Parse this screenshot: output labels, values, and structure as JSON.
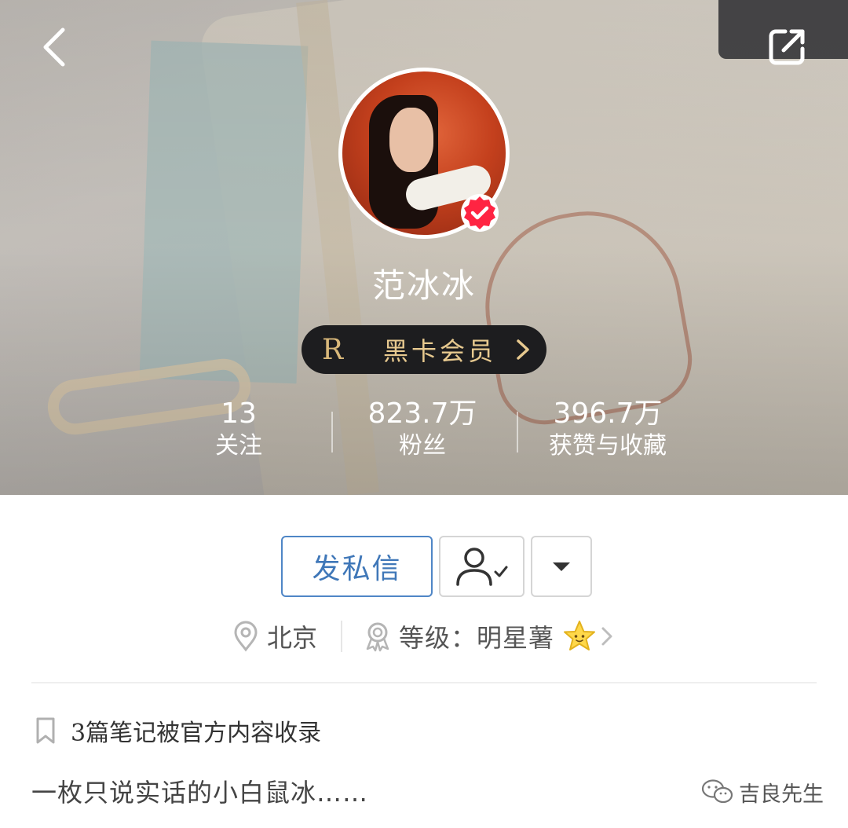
{
  "profile": {
    "name": "范冰冰",
    "verified_icon": "verified-badge-icon",
    "vip_letter": "R",
    "vip_label": "黑卡会员"
  },
  "stats": [
    {
      "value": "13",
      "label": "关注"
    },
    {
      "value": "823.7万",
      "label": "粉丝"
    },
    {
      "value": "396.7万",
      "label": "获赞与收藏"
    }
  ],
  "actions": {
    "message_label": "发私信",
    "follow_icon": "user-check-icon",
    "more_icon": "caret-down-icon"
  },
  "meta": {
    "location": "北京",
    "level": "等级：明星薯"
  },
  "collected_text": "3篇笔记被官方内容收录",
  "bio": "一枚只说实话的小白鼠冰……",
  "watermark": "吉良先生",
  "colors": {
    "accent_blue": "#3f77b8",
    "verified_red": "#ff2442",
    "vip_gold": "#e7c98f",
    "vip_bg": "#1d1d1f"
  }
}
